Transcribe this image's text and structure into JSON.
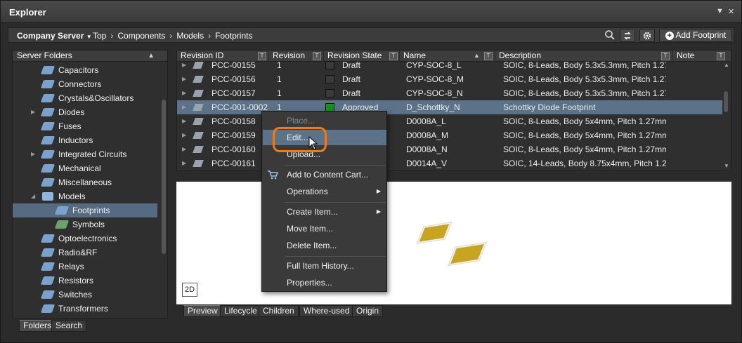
{
  "window": {
    "title": "Explorer"
  },
  "toolbar": {
    "server": "Company Server",
    "breadcrumbs": [
      "Top",
      "Components",
      "Models",
      "Footprints"
    ],
    "add_label": "Add Footprint"
  },
  "left": {
    "header": "Server Folders",
    "items": [
      {
        "label": "Capacitors",
        "expand": false
      },
      {
        "label": "Connectors",
        "expand": false
      },
      {
        "label": "Crystals&Oscillators",
        "expand": false
      },
      {
        "label": "Diodes",
        "expand": true
      },
      {
        "label": "Fuses",
        "expand": false
      },
      {
        "label": "Inductors",
        "expand": false
      },
      {
        "label": "Integrated Circuits",
        "expand": true
      },
      {
        "label": "Mechanical",
        "expand": false
      },
      {
        "label": "Miscellaneous",
        "expand": false
      },
      {
        "label": "Models",
        "expand": true
      },
      {
        "label": "Footprints",
        "expand": false
      },
      {
        "label": "Symbols",
        "expand": false
      },
      {
        "label": "Optoelectronics",
        "expand": false
      },
      {
        "label": "Radio&RF",
        "expand": false
      },
      {
        "label": "Relays",
        "expand": false
      },
      {
        "label": "Resistors",
        "expand": false
      },
      {
        "label": "Switches",
        "expand": false
      },
      {
        "label": "Transformers",
        "expand": false
      }
    ],
    "tabs": [
      "Folders",
      "Search"
    ]
  },
  "grid": {
    "columns": [
      "Revision ID",
      "Revision",
      "Revision State",
      "Name",
      "Description",
      "Note"
    ],
    "rows": [
      {
        "id": "PCC-00155",
        "rev": "1",
        "state": "Draft",
        "state_color": "#3a3a3a",
        "name": "CYP-SOC-8_L",
        "desc": "SOIC, 8-Leads, Body 5.3x5.3mm, Pitch 1.27mm,..."
      },
      {
        "id": "PCC-00156",
        "rev": "1",
        "state": "Draft",
        "state_color": "#3a3a3a",
        "name": "CYP-SOC-8_M",
        "desc": "SOIC, 8-Leads, Body 5.3x5.3mm, Pitch 1.27mm,..."
      },
      {
        "id": "PCC-00157",
        "rev": "1",
        "state": "Draft",
        "state_color": "#3a3a3a",
        "name": "CYP-SOC-8_N",
        "desc": "SOIC, 8-Leads, Body 5.3x5.3mm, Pitch 1.27mm,..."
      },
      {
        "id": "PCC-001-0002",
        "rev": "1",
        "state": "Approved",
        "state_color": "#1a8f1a",
        "name": "D_Schottky_N",
        "desc": "Schottky Diode Footprint"
      },
      {
        "id": "PCC-00158",
        "rev": "",
        "state": "",
        "state_color": "",
        "name": "D0008A_L",
        "desc": "SOIC, 8-Leads, Body 5x4mm, Pitch 1.27mm, IP..."
      },
      {
        "id": "PCC-00159",
        "rev": "",
        "state": "",
        "state_color": "",
        "name": "D0008A_M",
        "desc": "SOIC, 8-Leads, Body 5x4mm, Pitch 1.27mm, IP..."
      },
      {
        "id": "PCC-00160",
        "rev": "",
        "state": "",
        "state_color": "",
        "name": "D0008A_N",
        "desc": "SOIC, 8-Leads, Body 5x4mm, Pitch 1.27mm, IP..."
      },
      {
        "id": "PCC-00161",
        "rev": "",
        "state": "",
        "state_color": "",
        "name": "D0014A_V",
        "desc": "SOIC, 14-Leads, Body 8.75x4mm, Pitch 1.27mm"
      }
    ]
  },
  "preview": {
    "view_toggle": "2D"
  },
  "preview_tabs": [
    "Preview",
    "Lifecycle",
    "Children",
    "Where-used",
    "Origin"
  ],
  "context_menu": {
    "items": [
      {
        "label": "Place...",
        "disabled": true
      },
      {
        "label": "Edit...",
        "hover": true
      },
      {
        "label": "Upload..."
      },
      {
        "label": "Add to Content Cart..."
      },
      {
        "label": "Operations"
      },
      {
        "label": "Create Item..."
      },
      {
        "label": "Move Item..."
      },
      {
        "label": "Delete Item..."
      },
      {
        "label": "Full Item History..."
      },
      {
        "label": "Properties..."
      }
    ]
  },
  "colors": {
    "selection": "#5b7288",
    "highlight": "#f07a18",
    "pad": "#c8a520"
  }
}
